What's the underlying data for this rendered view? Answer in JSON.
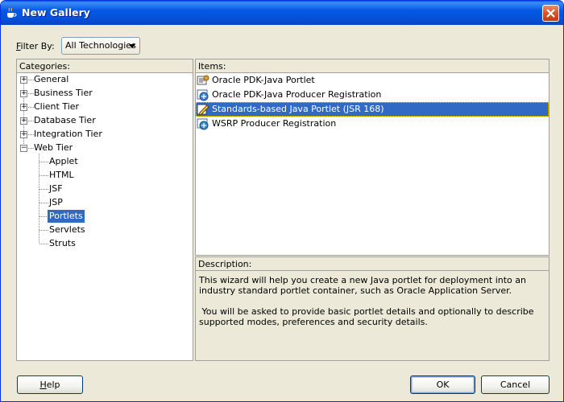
{
  "window": {
    "title": "New Gallery"
  },
  "filter": {
    "label": "Filter By:",
    "selected": "All Technologies"
  },
  "categories": {
    "header": "Categories:",
    "nodes": [
      {
        "label": "General",
        "expanded": false
      },
      {
        "label": "Business Tier",
        "expanded": false
      },
      {
        "label": "Client Tier",
        "expanded": false
      },
      {
        "label": "Database Tier",
        "expanded": false
      },
      {
        "label": "Integration Tier",
        "expanded": false
      },
      {
        "label": "Web Tier",
        "expanded": true
      }
    ],
    "web_tier_children": [
      "Applet",
      "HTML",
      "JSF",
      "JSP",
      "Portlets",
      "Servlets",
      "Struts"
    ],
    "selected": "Portlets"
  },
  "items": {
    "header": "Items:",
    "list": [
      {
        "label": "Oracle PDK-Java Portlet",
        "icon": "portlet-icon"
      },
      {
        "label": "Oracle PDK-Java Producer Registration",
        "icon": "registration-icon"
      },
      {
        "label": "Standards-based Java Portlet (JSR 168)",
        "icon": "wizard-edit-icon"
      },
      {
        "label": "WSRP Producer Registration",
        "icon": "registration-icon"
      }
    ],
    "selected": "Standards-based Java Portlet (JSR 168)"
  },
  "description": {
    "header": "Description:",
    "paragraph1": "This wizard will help you create a new Java portlet for deployment into an industry standard portlet container,  such as Oracle Application Server.",
    "paragraph2": " You will be asked to provide basic portlet details and optionally to describe supported modes, preferences and security details."
  },
  "buttons": {
    "help": "Help",
    "ok": "OK",
    "cancel": "Cancel"
  },
  "colors": {
    "selection": "#316ac5",
    "titlebar": "#0558e6",
    "dialog_bg": "#ece9d8"
  }
}
